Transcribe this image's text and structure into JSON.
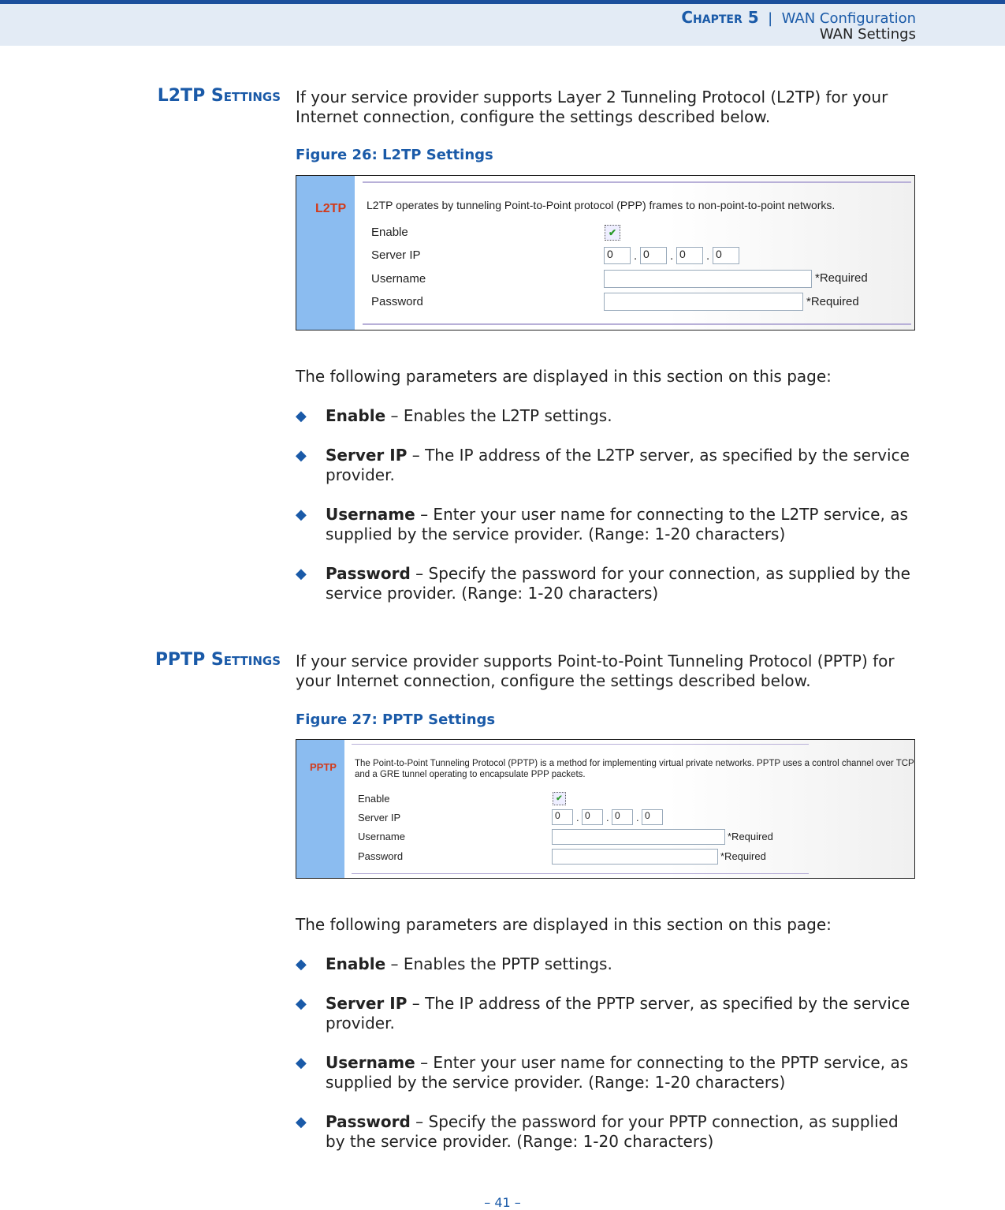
{
  "header": {
    "chapter": "Chapter 5",
    "separator": "|",
    "chapter_title": "WAN Configuration",
    "section": "WAN Settings"
  },
  "l2tp": {
    "heading": "L2TP Settings",
    "intro": "If your service provider supports Layer 2 Tunneling Protocol (L2TP) for your Internet connection, configure the settings described below.",
    "figure_caption": "Figure 26:  L2TP Settings",
    "screenshot": {
      "tag": "L2TP",
      "description": "L2TP operates by tunneling Point-to-Point protocol (PPP) frames to non-point-to-point networks.",
      "enable_label": "Enable",
      "enable_checked": true,
      "check": "✔",
      "server_ip_label": "Server IP",
      "server_ip": [
        "0",
        "0",
        "0",
        "0"
      ],
      "username_label": "Username",
      "username_value": "",
      "password_label": "Password",
      "password_value": "",
      "required": "*Required",
      "ip_sep": "."
    },
    "params_intro": "The following parameters are displayed in this section on this page:",
    "params": [
      {
        "term": "Enable",
        "desc": " – Enables the L2TP settings."
      },
      {
        "term": "Server IP",
        "desc": " – The IP address of the L2TP server, as specified by the service provider."
      },
      {
        "term": "Username",
        "desc": " – Enter your user name for connecting to the L2TP service, as supplied by the service provider. (Range: 1-20 characters)"
      },
      {
        "term": "Password",
        "desc": " – Specify the password for your connection, as supplied by the service provider. (Range: 1-20 characters)"
      }
    ]
  },
  "pptp": {
    "heading": "PPTP Settings",
    "intro": "If your service provider supports Point-to-Point Tunneling Protocol (PPTP) for your Internet connection, configure the settings described below.",
    "figure_caption": "Figure 27:  PPTP Settings",
    "screenshot": {
      "tag": "PPTP",
      "description": "The Point-to-Point Tunneling Protocol (PPTP) is a method for implementing virtual private networks. PPTP uses a control channel over TCP and a GRE tunnel operating to encapsulate PPP packets.",
      "enable_label": "Enable",
      "enable_checked": true,
      "check": "✔",
      "server_ip_label": "Server IP",
      "server_ip": [
        "0",
        "0",
        "0",
        "0"
      ],
      "username_label": "Username",
      "username_value": "",
      "password_label": "Password",
      "password_value": "",
      "required": "*Required",
      "ip_sep": "."
    },
    "params_intro": "The following parameters are displayed in this section on this page:",
    "params": [
      {
        "term": "Enable",
        "desc": " – Enables the PPTP settings."
      },
      {
        "term": "Server IP",
        "desc": " – The IP address of the PPTP server, as specified by the service provider."
      },
      {
        "term": "Username",
        "desc": " – Enter your user name for connecting to the PPTP service, as supplied by the service provider. (Range: 1-20 characters)"
      },
      {
        "term": "Password",
        "desc": " – Specify the password for your PPTP connection, as supplied by the service provider. (Range: 1-20 characters)"
      }
    ]
  },
  "bullet_glyph": "◆",
  "footer": {
    "page": "–  41  –"
  },
  "colors": {
    "accent": "#1a5aa8",
    "tag": "#d23a1a",
    "sidebar": "#8bbcf0"
  }
}
